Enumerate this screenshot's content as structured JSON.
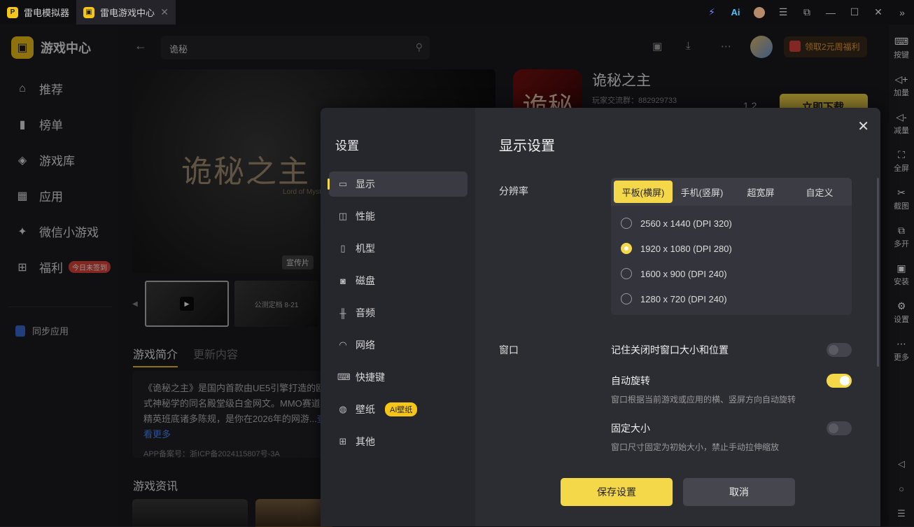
{
  "titlebar": {
    "tabs": [
      {
        "label": "雷电模拟器"
      },
      {
        "label": "雷电游戏中心"
      }
    ]
  },
  "sidebar": {
    "brand": "游戏中心",
    "items": [
      {
        "label": "推荐",
        "icon": "home-icon"
      },
      {
        "label": "榜单",
        "icon": "chart-icon"
      },
      {
        "label": "游戏库",
        "icon": "gamepad-icon"
      },
      {
        "label": "应用",
        "icon": "apps-icon"
      },
      {
        "label": "微信小游戏",
        "icon": "wechat-game-icon"
      },
      {
        "label": "福利",
        "icon": "gift-icon",
        "badge": "今日未签到"
      }
    ],
    "sync": "同步应用"
  },
  "header": {
    "search_value": "诡秘",
    "promo": "领取2元周福利"
  },
  "game": {
    "name": "诡秘之主",
    "group": "玩家交流群：882929733",
    "size": "1.2",
    "download": "立即下载",
    "banner_title": "诡秘之主",
    "banner_sub": "Lord of Mysteries",
    "banner_tag": "宣传片",
    "thumb2": "公测定档 8-21",
    "tabs": [
      "游戏简介",
      "更新内容"
    ],
    "intro": "《诡秘之主》是国内首款由UE5引擎打造的欧式神秘学的同名殿堂级白金网文。MMO赛道全精英班底诸多陈规，是你在2026年的网游...",
    "intro_more": "查看更多",
    "icp": "APP备案号：浙ICP备2024115807号-3A",
    "news_title": "游戏资讯"
  },
  "rightbar": {
    "items": [
      {
        "label": "按键",
        "icon": "keyboard-icon"
      },
      {
        "label": "加量",
        "icon": "volume-up-icon"
      },
      {
        "label": "减量",
        "icon": "volume-down-icon"
      },
      {
        "label": "全屏",
        "icon": "fullscreen-icon"
      },
      {
        "label": "截图",
        "icon": "scissors-icon"
      },
      {
        "label": "多开",
        "icon": "multi-icon"
      },
      {
        "label": "安装",
        "icon": "apk-icon"
      },
      {
        "label": "设置",
        "icon": "gear-icon"
      },
      {
        "label": "更多",
        "icon": "more-icon"
      }
    ]
  },
  "dialog": {
    "nav_title": "设置",
    "nav": [
      {
        "label": "显示",
        "icon": "monitor-icon"
      },
      {
        "label": "性能",
        "icon": "performance-icon"
      },
      {
        "label": "机型",
        "icon": "phone-icon"
      },
      {
        "label": "磁盘",
        "icon": "disk-icon"
      },
      {
        "label": "音频",
        "icon": "audio-icon"
      },
      {
        "label": "网络",
        "icon": "wifi-icon"
      },
      {
        "label": "快捷键",
        "icon": "keyboard-icon"
      },
      {
        "label": "壁纸",
        "icon": "palette-icon",
        "badge": "AI壁纸"
      },
      {
        "label": "其他",
        "icon": "grid-icon"
      }
    ],
    "title": "显示设置",
    "resolution_label": "分辨率",
    "segments": [
      "平板(横屏)",
      "手机(竖屏)",
      "超宽屏",
      "自定义"
    ],
    "selected_segment": "平板(横屏)",
    "resolutions": [
      "2560 x 1440  (DPI 320)",
      "1920 x 1080  (DPI 280)",
      "1600 x 900  (DPI 240)",
      "1280 x 720  (DPI 240)"
    ],
    "selected_resolution": "1920 x 1080  (DPI 280)",
    "window_label": "窗口",
    "options": [
      {
        "title": "记住关闭时窗口大小和位置",
        "desc": "",
        "on": false
      },
      {
        "title": "自动旋转",
        "desc": "窗口根据当前游戏或应用的横、竖屏方向自动旋转",
        "on": true
      },
      {
        "title": "固定大小",
        "desc": "窗口尺寸固定为初始大小，禁止手动拉伸缩放",
        "on": false
      }
    ],
    "save": "保存设置",
    "cancel": "取消"
  },
  "colors": {
    "accent": "#f5d84a",
    "bg": "#1a1a1e",
    "dialog": "#2c2c33"
  }
}
